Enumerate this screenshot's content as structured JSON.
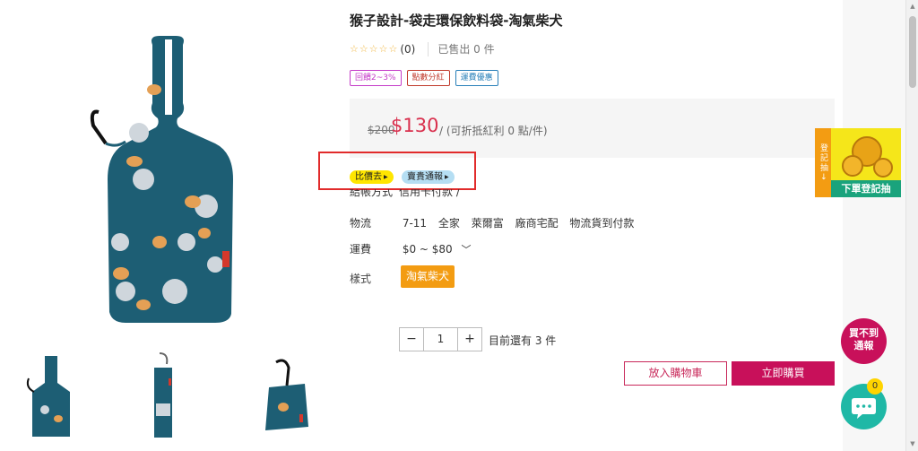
{
  "product": {
    "title": "猴子設計-袋走環保飲料袋-淘氣柴犬",
    "stars": "☆☆☆☆☆",
    "rating_count": "(0)",
    "sold": "已售出 0 件"
  },
  "tags": [
    "回饋2~3%",
    "點數分紅",
    "運費優惠"
  ],
  "price": {
    "original": "$200",
    "current": "$130",
    "note": "/ (可折抵紅利 0 點/件)"
  },
  "actions_highlight": {
    "compare_label": "比價去",
    "notify_label": "賣貴通報"
  },
  "payment": {
    "label": "結帳方式",
    "value": "信用卡付款 /"
  },
  "logistics": {
    "label": "物流",
    "options": [
      "7-11",
      "全家",
      "萊爾富",
      "廠商宅配",
      "物流貨到付款"
    ]
  },
  "shipping": {
    "label": "運費",
    "value": "$0 ~ $80"
  },
  "style": {
    "label": "樣式",
    "selected": "淘氣柴犬"
  },
  "quantity": {
    "minus": "−",
    "value": "1",
    "plus": "+",
    "stock": "目前還有 3 件"
  },
  "buttons": {
    "add_to_cart": "放入購物車",
    "buy_now": "立即購買"
  },
  "promo": {
    "side_label": "登記抽",
    "arrow": "→",
    "caption": "下單登記抽"
  },
  "floating": {
    "notify_line1": "買不到",
    "notify_line2": "通報",
    "chat_badge": "0"
  },
  "colors": {
    "price_red": "#d9304e",
    "brand_pink": "#c8105a",
    "style_orange": "#f39c12",
    "chat_teal": "#1fb8a6",
    "bag_teal": "#1d5e74"
  }
}
